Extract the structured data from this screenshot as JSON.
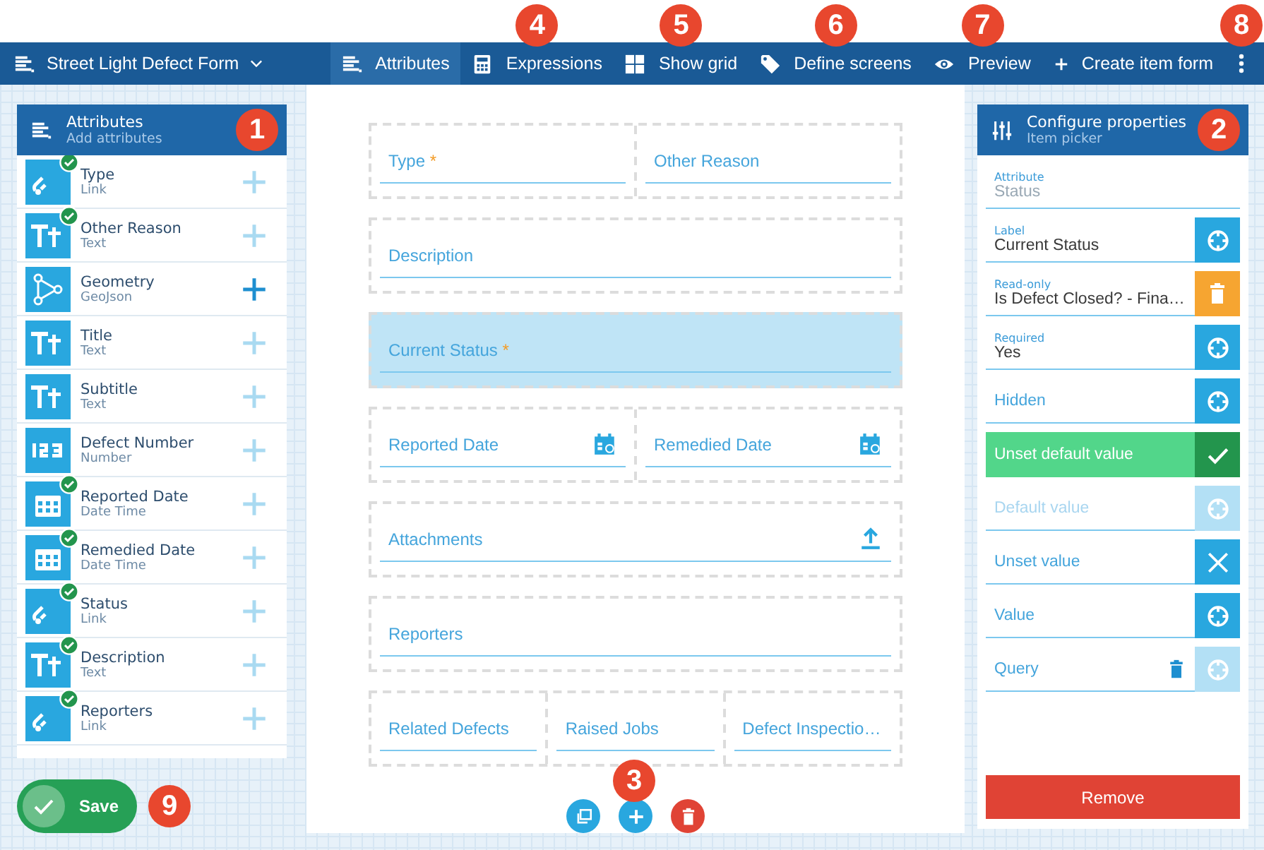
{
  "toolbar": {
    "form_title": "Street Light Defect Form",
    "more_callout": "8",
    "items": [
      {
        "label": "Attributes",
        "kind": "list",
        "selected": true
      },
      {
        "label": "Expressions",
        "kind": "calculator",
        "selected": false,
        "callout": "4"
      },
      {
        "label": "Show grid",
        "kind": "grid",
        "selected": false,
        "callout": "5"
      },
      {
        "label": "Define screens",
        "kind": "tag",
        "selected": false,
        "callout": "6"
      },
      {
        "label": "Preview",
        "kind": "eye",
        "selected": false,
        "callout": "7"
      },
      {
        "label": "Create item form",
        "kind": "plus",
        "selected": false
      }
    ]
  },
  "attributes_panel": {
    "title": "Attributes",
    "subtitle": "Add attributes",
    "callout": "1",
    "items": [
      {
        "name": "Type",
        "type": "Link",
        "kind": "link",
        "checked": true,
        "selected": false
      },
      {
        "name": "Other Reason",
        "type": "Text",
        "kind": "text",
        "checked": true,
        "selected": false
      },
      {
        "name": "Geometry",
        "type": "GeoJson",
        "kind": "geometry",
        "checked": false,
        "selected": true
      },
      {
        "name": "Title",
        "type": "Text",
        "kind": "text",
        "checked": false,
        "selected": false
      },
      {
        "name": "Subtitle",
        "type": "Text",
        "kind": "text",
        "checked": false,
        "selected": false
      },
      {
        "name": "Defect Number",
        "type": "Number",
        "kind": "number",
        "checked": false,
        "selected": false
      },
      {
        "name": "Reported Date",
        "type": "Date Time",
        "kind": "date",
        "checked": true,
        "selected": false
      },
      {
        "name": "Remedied Date",
        "type": "Date Time",
        "kind": "date",
        "checked": true,
        "selected": false
      },
      {
        "name": "Status",
        "type": "Link",
        "kind": "link",
        "checked": true,
        "selected": false
      },
      {
        "name": "Description",
        "type": "Text",
        "kind": "text",
        "checked": true,
        "selected": false
      },
      {
        "name": "Reporters",
        "type": "Link",
        "kind": "link",
        "checked": true,
        "selected": false
      }
    ]
  },
  "form": {
    "callout": "3",
    "actions": [
      {
        "kind": "copy"
      },
      {
        "kind": "add"
      },
      {
        "kind": "delete"
      }
    ],
    "rows": [
      {
        "selected": false,
        "fields": [
          {
            "label": "Type",
            "required_mark": "*"
          },
          {
            "label": "Other Reason"
          }
        ]
      },
      {
        "selected": false,
        "fields": [
          {
            "label": "Description"
          }
        ]
      },
      {
        "selected": true,
        "fields": [
          {
            "label": "Current Status",
            "required_mark": "*"
          }
        ]
      },
      {
        "selected": false,
        "fields": [
          {
            "label": "Reported Date",
            "kind": "calendar"
          },
          {
            "label": "Remedied Date",
            "kind": "calendar"
          }
        ]
      },
      {
        "selected": false,
        "fields": [
          {
            "label": "Attachments",
            "kind": "upload"
          }
        ]
      },
      {
        "selected": false,
        "fields": [
          {
            "label": "Reporters"
          }
        ]
      },
      {
        "selected": false,
        "fields": [
          {
            "label": "Related Defects"
          },
          {
            "label": "Raised Jobs"
          },
          {
            "label": "Defect Inspectio…"
          }
        ]
      }
    ]
  },
  "properties_panel": {
    "title": "Configure properties",
    "subtitle": "Item picker",
    "callout": "2",
    "properties": [
      {
        "caption": "Attribute",
        "text": "Status",
        "kind": "static",
        "disabled": true,
        "on": false
      },
      {
        "caption": "Label",
        "text": "Current Status",
        "kind": "target",
        "disabled": false,
        "on": false,
        "action_disabled": false
      },
      {
        "caption": "Read-only",
        "text": "Is Defect Closed? - Fina…",
        "kind": "delete",
        "disabled": false,
        "on": false,
        "action_disabled": false
      },
      {
        "caption": "Required",
        "text": "Yes",
        "kind": "target",
        "disabled": false,
        "on": false,
        "action_disabled": false
      },
      {
        "text": "Hidden",
        "kind": "target",
        "disabled": false,
        "on": false,
        "action_disabled": false
      },
      {
        "text": "Unset default value",
        "kind": "check",
        "disabled": false,
        "on": true,
        "action_disabled": false
      },
      {
        "text": "Default value",
        "kind": "target",
        "disabled": true,
        "on": false,
        "action_disabled": true
      },
      {
        "text": "Unset value",
        "kind": "clear",
        "disabled": false,
        "on": false,
        "action_disabled": false
      },
      {
        "text": "Value",
        "kind": "target",
        "disabled": false,
        "on": false,
        "action_disabled": false
      },
      {
        "text": "Query",
        "kind": "target",
        "disabled": false,
        "on": false,
        "action_disabled": true,
        "trash": true
      }
    ],
    "remove_label": "Remove"
  },
  "save": {
    "label": "Save",
    "callout": "9"
  }
}
